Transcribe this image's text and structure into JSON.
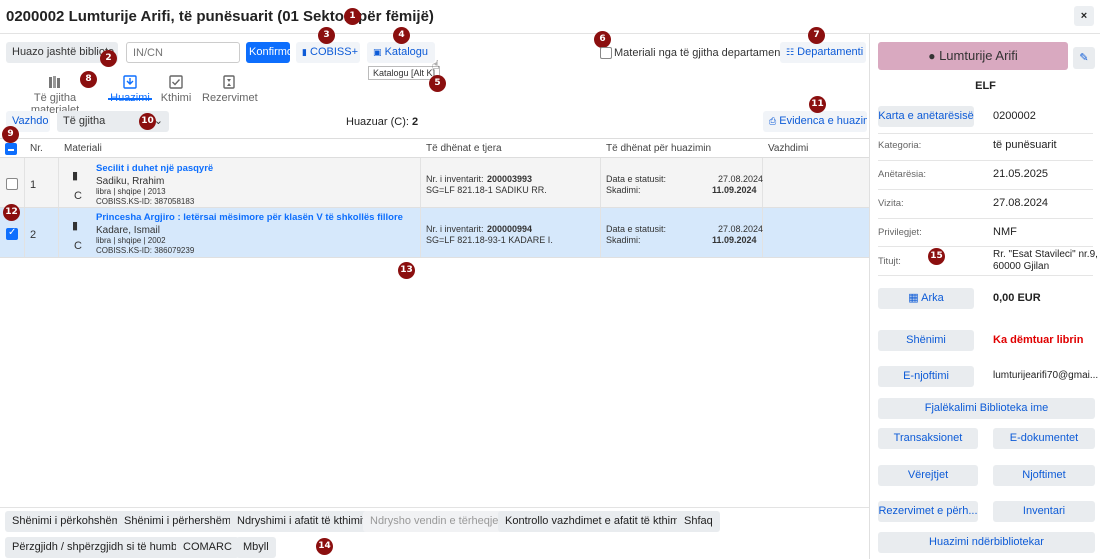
{
  "header": {
    "title": "0200002 Lumturije Arifi, të punësuarit (01 Sektori për fëmijë)",
    "close": "×"
  },
  "toolbar": {
    "outside_library": "Huazo jashtë bibliote",
    "in_cn_placeholder": "IN/CN",
    "confirm": "Konfirmo",
    "cobiss": "COBISS+",
    "catalog": "Katalogu",
    "catalog_tooltip": "Katalogu [Alt K]",
    "all_departments_label": "Materiali nga të gjitha departamentet",
    "departments": "Departamenti"
  },
  "tabs": [
    {
      "label": "Të gjitha materialet"
    },
    {
      "label": "Huazimi"
    },
    {
      "label": "Kthimi"
    },
    {
      "label": "Rezervimet"
    }
  ],
  "subbar": {
    "extend": "Vazhdo",
    "filter_value": "Të gjitha",
    "borrowed_label": "Huazuar (C):",
    "borrowed_count": "2",
    "evidence": "Evidenca e huazimit"
  },
  "table": {
    "headers": {
      "nr": "Nr.",
      "material": "Materiali",
      "other": "Të dhënat e tjera",
      "loan": "Të dhënat për huazimin",
      "reminders": "Vazhdimi"
    },
    "rows": [
      {
        "nr": "1",
        "type": "C",
        "title": "Secilit i duhet një pasqyrë",
        "author": "Sadiku, Rrahim",
        "meta": "libra | shqipe | 2013",
        "cobiss_id": "COBISS.KS-ID: 387058183",
        "inv_label": "Nr. i inventarit:",
        "inv": "200003993",
        "sg": "SG=LF 821.18-1 SADIKU RR.",
        "status_label": "Data e statusit:",
        "status_date": "27.08.2024",
        "due_label": "Skadimi:",
        "due_date": "11.09.2024",
        "checked": false
      },
      {
        "nr": "2",
        "type": "C",
        "title": "Princesha Argjiro : letërsai mësimore për klasën V të shkollës fillore",
        "author": "Kadare, Ismail",
        "meta": "libra | shqipe | 2002",
        "cobiss_id": "COBISS.KS-ID: 386079239",
        "inv_label": "Nr. i inventarit:",
        "inv": "200000994",
        "sg": "SG=LF 821.18-93-1 KADARE I.",
        "status_label": "Data e statusit:",
        "status_date": "27.08.2024",
        "due_label": "Skadimi:",
        "due_date": "11.09.2024",
        "checked": true
      }
    ]
  },
  "bottom": {
    "b1": "Shënimi i përkohshëm",
    "b2": "Shënimi i përhershëm",
    "b3": "Ndryshimi i afatit të kthimit",
    "b4": "Ndrysho vendin e tërheqjes",
    "b5": "Kontrollo vazhdimet e afatit të kthimit",
    "b6": "Shfaq",
    "b7": "Përzgjidh / shpërzgjidh si të humbur",
    "b8": "COMARC",
    "b9": "Mbyll"
  },
  "member": {
    "name": "Lumturije Arifi",
    "code": "ELF",
    "card_btn": "Karta e anëtarësisë",
    "card_no": "0200002",
    "category_label": "Kategoria:",
    "category": "të punësuarit",
    "membership_label": "Anëtarësia:",
    "membership": "21.05.2025",
    "visit_label": "Vizita:",
    "visit": "27.08.2024",
    "privileges_label": "Privilegjet:",
    "privileges": "NMF",
    "address_label": "Titujt:",
    "address_line1": "Rr. \"Esat Stavileci\" nr.9,",
    "address_line2": "60000 Gjilan",
    "cash_btn": "Arka",
    "cash_value": "0,00 EUR",
    "note_btn": "Shënimi",
    "note_value": "Ka dëmtuar librin",
    "email_btn": "E-njoftimi",
    "email_value": "lumturijearifi70@gmai...",
    "password_btn": "Fjalëkalimi Biblioteka ime",
    "transactions_btn": "Transaksionet",
    "edocs_btn": "E-dokumentet",
    "remarks_btn": "Vërejtjet",
    "notices_btn": "Njoftimet",
    "reservations_btn": "Rezervimet e përh...",
    "inventory_btn": "Inventari",
    "interlibrary_btn": "Huazimi ndërbibliotekar"
  },
  "colors": {
    "accent": "#0d6efd",
    "marker": "#8b0f0f",
    "member_bg": "#d9a9c0",
    "danger": "#e00000",
    "selected_row": "#d6e8fb"
  },
  "markers": [
    "1",
    "2",
    "3",
    "4",
    "5",
    "6",
    "7",
    "8",
    "9",
    "10",
    "11",
    "12",
    "13",
    "14",
    "15"
  ]
}
